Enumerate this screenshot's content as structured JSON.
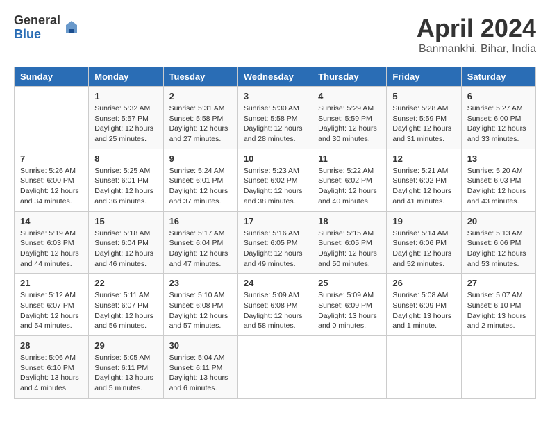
{
  "header": {
    "logo_general": "General",
    "logo_blue": "Blue",
    "month_title": "April 2024",
    "location": "Banmankhi, Bihar, India"
  },
  "weekdays": [
    "Sunday",
    "Monday",
    "Tuesday",
    "Wednesday",
    "Thursday",
    "Friday",
    "Saturday"
  ],
  "weeks": [
    [
      {
        "day": "",
        "info": ""
      },
      {
        "day": "1",
        "info": "Sunrise: 5:32 AM\nSunset: 5:57 PM\nDaylight: 12 hours\nand 25 minutes."
      },
      {
        "day": "2",
        "info": "Sunrise: 5:31 AM\nSunset: 5:58 PM\nDaylight: 12 hours\nand 27 minutes."
      },
      {
        "day": "3",
        "info": "Sunrise: 5:30 AM\nSunset: 5:58 PM\nDaylight: 12 hours\nand 28 minutes."
      },
      {
        "day": "4",
        "info": "Sunrise: 5:29 AM\nSunset: 5:59 PM\nDaylight: 12 hours\nand 30 minutes."
      },
      {
        "day": "5",
        "info": "Sunrise: 5:28 AM\nSunset: 5:59 PM\nDaylight: 12 hours\nand 31 minutes."
      },
      {
        "day": "6",
        "info": "Sunrise: 5:27 AM\nSunset: 6:00 PM\nDaylight: 12 hours\nand 33 minutes."
      }
    ],
    [
      {
        "day": "7",
        "info": "Sunrise: 5:26 AM\nSunset: 6:00 PM\nDaylight: 12 hours\nand 34 minutes."
      },
      {
        "day": "8",
        "info": "Sunrise: 5:25 AM\nSunset: 6:01 PM\nDaylight: 12 hours\nand 36 minutes."
      },
      {
        "day": "9",
        "info": "Sunrise: 5:24 AM\nSunset: 6:01 PM\nDaylight: 12 hours\nand 37 minutes."
      },
      {
        "day": "10",
        "info": "Sunrise: 5:23 AM\nSunset: 6:02 PM\nDaylight: 12 hours\nand 38 minutes."
      },
      {
        "day": "11",
        "info": "Sunrise: 5:22 AM\nSunset: 6:02 PM\nDaylight: 12 hours\nand 40 minutes."
      },
      {
        "day": "12",
        "info": "Sunrise: 5:21 AM\nSunset: 6:02 PM\nDaylight: 12 hours\nand 41 minutes."
      },
      {
        "day": "13",
        "info": "Sunrise: 5:20 AM\nSunset: 6:03 PM\nDaylight: 12 hours\nand 43 minutes."
      }
    ],
    [
      {
        "day": "14",
        "info": "Sunrise: 5:19 AM\nSunset: 6:03 PM\nDaylight: 12 hours\nand 44 minutes."
      },
      {
        "day": "15",
        "info": "Sunrise: 5:18 AM\nSunset: 6:04 PM\nDaylight: 12 hours\nand 46 minutes."
      },
      {
        "day": "16",
        "info": "Sunrise: 5:17 AM\nSunset: 6:04 PM\nDaylight: 12 hours\nand 47 minutes."
      },
      {
        "day": "17",
        "info": "Sunrise: 5:16 AM\nSunset: 6:05 PM\nDaylight: 12 hours\nand 49 minutes."
      },
      {
        "day": "18",
        "info": "Sunrise: 5:15 AM\nSunset: 6:05 PM\nDaylight: 12 hours\nand 50 minutes."
      },
      {
        "day": "19",
        "info": "Sunrise: 5:14 AM\nSunset: 6:06 PM\nDaylight: 12 hours\nand 52 minutes."
      },
      {
        "day": "20",
        "info": "Sunrise: 5:13 AM\nSunset: 6:06 PM\nDaylight: 12 hours\nand 53 minutes."
      }
    ],
    [
      {
        "day": "21",
        "info": "Sunrise: 5:12 AM\nSunset: 6:07 PM\nDaylight: 12 hours\nand 54 minutes."
      },
      {
        "day": "22",
        "info": "Sunrise: 5:11 AM\nSunset: 6:07 PM\nDaylight: 12 hours\nand 56 minutes."
      },
      {
        "day": "23",
        "info": "Sunrise: 5:10 AM\nSunset: 6:08 PM\nDaylight: 12 hours\nand 57 minutes."
      },
      {
        "day": "24",
        "info": "Sunrise: 5:09 AM\nSunset: 6:08 PM\nDaylight: 12 hours\nand 58 minutes."
      },
      {
        "day": "25",
        "info": "Sunrise: 5:09 AM\nSunset: 6:09 PM\nDaylight: 13 hours\nand 0 minutes."
      },
      {
        "day": "26",
        "info": "Sunrise: 5:08 AM\nSunset: 6:09 PM\nDaylight: 13 hours\nand 1 minute."
      },
      {
        "day": "27",
        "info": "Sunrise: 5:07 AM\nSunset: 6:10 PM\nDaylight: 13 hours\nand 2 minutes."
      }
    ],
    [
      {
        "day": "28",
        "info": "Sunrise: 5:06 AM\nSunset: 6:10 PM\nDaylight: 13 hours\nand 4 minutes."
      },
      {
        "day": "29",
        "info": "Sunrise: 5:05 AM\nSunset: 6:11 PM\nDaylight: 13 hours\nand 5 minutes."
      },
      {
        "day": "30",
        "info": "Sunrise: 5:04 AM\nSunset: 6:11 PM\nDaylight: 13 hours\nand 6 minutes."
      },
      {
        "day": "",
        "info": ""
      },
      {
        "day": "",
        "info": ""
      },
      {
        "day": "",
        "info": ""
      },
      {
        "day": "",
        "info": ""
      }
    ]
  ]
}
